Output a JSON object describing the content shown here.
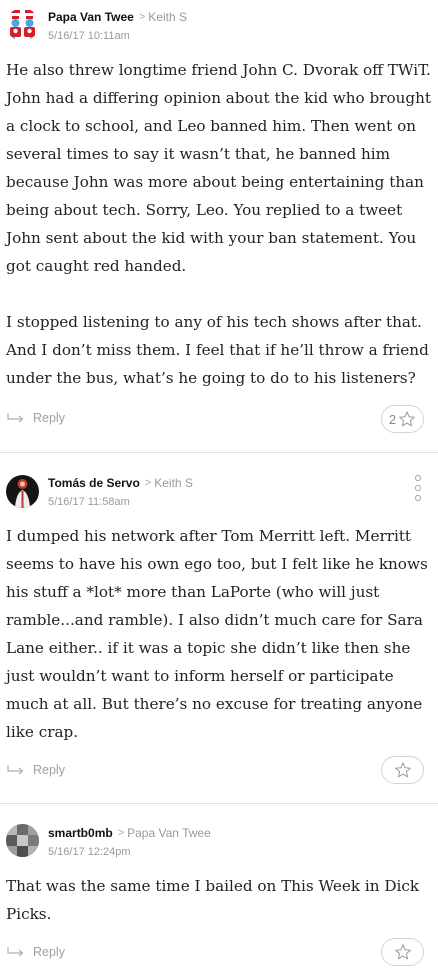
{
  "comments": [
    {
      "author": "Papa Van Twee",
      "reply_to": "Keith S",
      "timestamp": "5/16/17 10:11am",
      "paragraphs": [
        "He also threw longtime friend John C. Dvorak off TWiT. John had a differing opinion about the kid who brought a clock to school, and Leo banned him. Then went on several times to say it wasn’t that, he banned him because John was more about being entertaining than being about tech. Sorry, Leo. You replied to a tweet John sent about the kid with your ban statement. You got caught red handed.",
        "I stopped listening to any of his tech shows after that. And I don’t miss them. I feel that if he’ll throw a friend under the bus, what’s he going to do to his listeners?"
      ],
      "reply_label": "Reply",
      "recommend_count": "2"
    },
    {
      "author": "Tomás de Servo",
      "reply_to": "Keith S",
      "timestamp": "5/16/17 11:58am",
      "paragraphs": [
        "I dumped his network after Tom Merritt left. Merritt seems to have his own ego too, but I felt like he knows his stuff a *lot* more than LaPorte (who will just ramble...and ramble). I also didn’t much care for Sara Lane either.. if it was a topic she didn’t like then she just wouldn’t want to inform herself or participate much at all. But there’s no excuse for treating anyone like crap."
      ],
      "reply_label": "Reply"
    },
    {
      "author": "smartb0mb",
      "reply_to": "Papa Van Twee",
      "timestamp": "5/16/17 12:24pm",
      "paragraphs": [
        "That was the same time I bailed on This Week in Dick Picks."
      ],
      "reply_label": "Reply"
    }
  ],
  "icons": {
    "reply": "reply-arrow-icon",
    "recommend": "star-icon",
    "more": "more-vertical-icon"
  },
  "colors": {
    "meta_gray": "#9a9a9a",
    "border": "#d4d4d4"
  }
}
